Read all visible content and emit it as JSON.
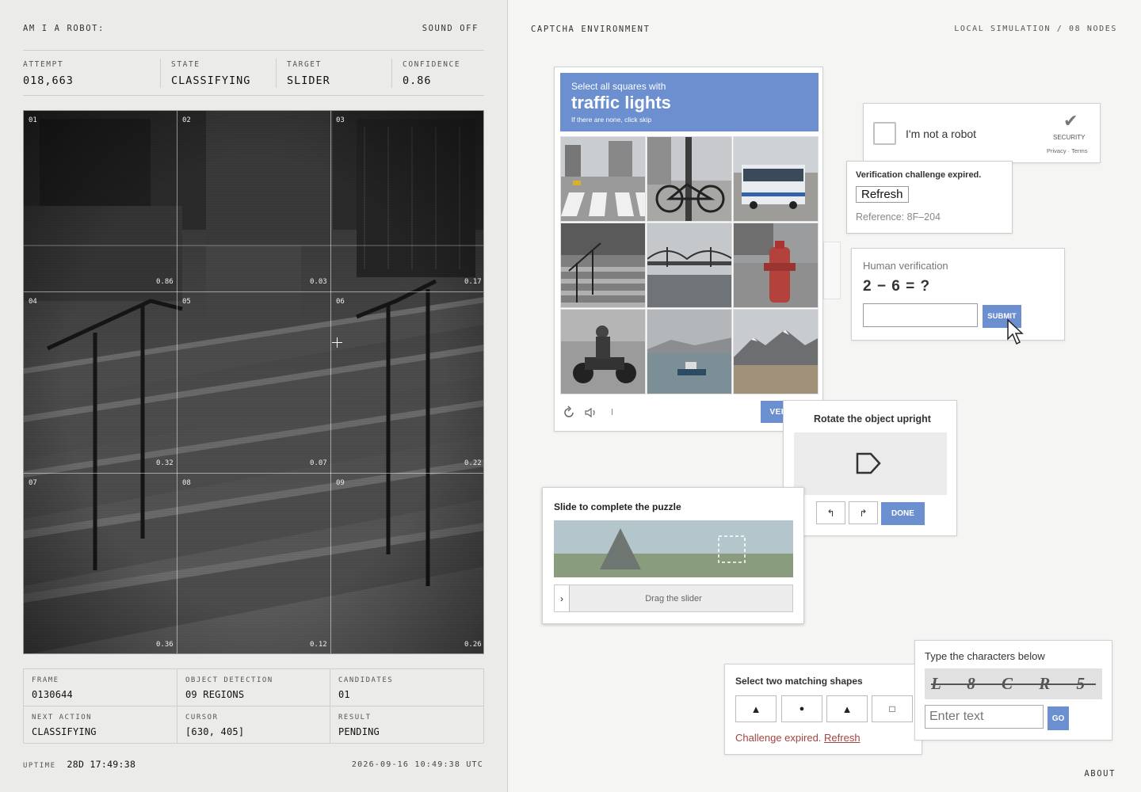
{
  "left": {
    "title": "AM I A ROBOT:",
    "sound": "SOUND OFF",
    "stats": [
      {
        "label": "ATTEMPT",
        "value": "018,663"
      },
      {
        "label": "STATE",
        "value": "CLASSIFYING"
      },
      {
        "label": "TARGET",
        "value": "SLIDER"
      },
      {
        "label": "CONFIDENCE",
        "value": "0.86"
      }
    ],
    "cells": [
      {
        "id": "01",
        "score": "0.86"
      },
      {
        "id": "02",
        "score": "0.03"
      },
      {
        "id": "03",
        "score": "0.17"
      },
      {
        "id": "04",
        "score": "0.32"
      },
      {
        "id": "05",
        "score": "0.07"
      },
      {
        "id": "06",
        "score": "0.22"
      },
      {
        "id": "07",
        "score": "0.36"
      },
      {
        "id": "08",
        "score": "0.12"
      },
      {
        "id": "09",
        "score": "0.26"
      }
    ],
    "info": [
      {
        "label": "FRAME",
        "value": "0130644"
      },
      {
        "label": "OBJECT DETECTION",
        "value": "09 REGIONS"
      },
      {
        "label": "CANDIDATES",
        "value": "01"
      },
      {
        "label": "NEXT ACTION",
        "value": "CLASSIFYING"
      },
      {
        "label": "CURSOR",
        "value": "[630, 405]"
      },
      {
        "label": "RESULT",
        "value": "PENDING"
      }
    ],
    "uptime_label": "UPTIME",
    "uptime": "28D 17:49:38",
    "datetime": "2026-09-16 10:49:38 UTC"
  },
  "right": {
    "title": "CAPTCHA ENVIRONMENT",
    "subtitle": "LOCAL SIMULATION / 08 NODES",
    "about": "ABOUT"
  },
  "recaptcha": {
    "line1": "Select all squares with",
    "line2": "traffic lights",
    "line3": "If there are none, click skip",
    "verify": "VERIFY",
    "tiles": [
      "crosswalk",
      "bicycle",
      "bus",
      "stairs",
      "bridge",
      "hydrant",
      "motorcycle",
      "boat",
      "mountains"
    ]
  },
  "notrobot": {
    "label": "I'm not a robot",
    "security": "SECURITY",
    "links": "Privacy · Terms"
  },
  "expired": {
    "title": "Verification challenge expired.",
    "button": "Refresh",
    "reference": "Reference: 8F–204"
  },
  "human": {
    "title": "Human verification",
    "question": "2 − 6 = ?",
    "submit": "SUBMIT"
  },
  "rotate": {
    "title": "Rotate the object upright",
    "done": "DONE"
  },
  "slide": {
    "title": "Slide to complete the puzzle",
    "drag": "Drag the slider",
    "handle": "›"
  },
  "shapes": {
    "title": "Select two matching shapes",
    "options": [
      "▲",
      "●",
      "▲",
      "□"
    ],
    "expired": "Challenge expired.",
    "refresh": "Refresh"
  },
  "chars": {
    "title": "Type the characters below",
    "captcha": "L 8 C R 5",
    "placeholder": "Enter text",
    "go": "GO"
  }
}
